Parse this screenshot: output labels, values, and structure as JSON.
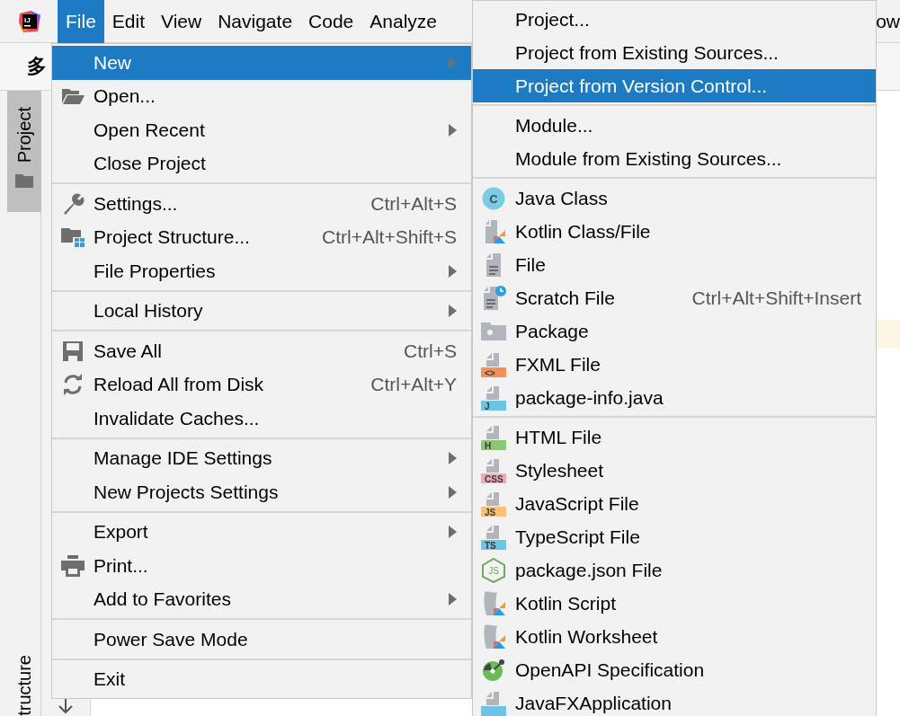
{
  "menubar": {
    "logo": "IJ",
    "items": [
      {
        "label": "File",
        "selected": true
      },
      {
        "label": "Edit",
        "selected": false
      },
      {
        "label": "View",
        "selected": false
      },
      {
        "label": "Navigate",
        "selected": false
      },
      {
        "label": "Code",
        "selected": false
      },
      {
        "label": "Analyze",
        "selected": false
      },
      {
        "label": "ow",
        "selected": false
      }
    ]
  },
  "toolbar_text": "多",
  "tool_windows": [
    {
      "label": "Project",
      "selected": true
    },
    {
      "label": "tructure",
      "selected": false
    }
  ],
  "file_menu": {
    "sections": [
      {
        "items": [
          {
            "label": "New",
            "selected": true,
            "submenu": true
          },
          {
            "label": "Open...",
            "selected": false,
            "submenu": false
          },
          {
            "label": "Open Recent",
            "selected": false,
            "submenu": true
          },
          {
            "label": "Close Project",
            "selected": false,
            "submenu": false
          }
        ]
      },
      {
        "items": [
          {
            "label": "Settings...",
            "shortcut": "Ctrl+Alt+S",
            "selected": false,
            "submenu": false
          },
          {
            "label": "Project Structure...",
            "shortcut": "Ctrl+Alt+Shift+S",
            "selected": false,
            "submenu": false
          },
          {
            "label": "File Properties",
            "selected": false,
            "submenu": true
          }
        ]
      },
      {
        "items": [
          {
            "label": "Local History",
            "selected": false,
            "submenu": true
          }
        ]
      },
      {
        "items": [
          {
            "label": "Save All",
            "shortcut": "Ctrl+S",
            "selected": false,
            "submenu": false
          },
          {
            "label": "Reload All from Disk",
            "shortcut": "Ctrl+Alt+Y",
            "selected": false,
            "submenu": false
          },
          {
            "label": "Invalidate Caches...",
            "selected": false,
            "submenu": false
          }
        ]
      },
      {
        "items": [
          {
            "label": "Manage IDE Settings",
            "selected": false,
            "submenu": true
          },
          {
            "label": "New Projects Settings",
            "selected": false,
            "submenu": true
          }
        ]
      },
      {
        "items": [
          {
            "label": "Export",
            "selected": false,
            "submenu": true
          },
          {
            "label": "Print...",
            "selected": false,
            "submenu": false
          },
          {
            "label": "Add to Favorites",
            "selected": false,
            "submenu": true
          }
        ]
      },
      {
        "items": [
          {
            "label": "Power Save Mode",
            "selected": false,
            "submenu": false
          }
        ]
      },
      {
        "items": [
          {
            "label": "Exit",
            "selected": false,
            "submenu": false
          }
        ]
      }
    ]
  },
  "new_submenu": {
    "sections": [
      {
        "items": [
          {
            "label": "Project...",
            "selected": false
          },
          {
            "label": "Project from Existing Sources...",
            "selected": false
          },
          {
            "label": "Project from Version Control...",
            "selected": true
          }
        ]
      },
      {
        "items": [
          {
            "label": "Module...",
            "selected": false
          },
          {
            "label": "Module from Existing Sources...",
            "selected": false
          }
        ]
      },
      {
        "items": [
          {
            "label": "Java Class",
            "badge": "C",
            "color": "#7ccbe4",
            "selected": false
          },
          {
            "label": "Kotlin Class/File",
            "selected": false
          },
          {
            "label": "File",
            "selected": false
          },
          {
            "label": "Scratch File",
            "shortcut": "Ctrl+Alt+Shift+Insert",
            "selected": false
          },
          {
            "label": "Package",
            "selected": false
          },
          {
            "label": "FXML File",
            "badge": "<>",
            "color": "#f0915a",
            "selected": false
          },
          {
            "label": "package-info.java",
            "badge": "J",
            "color": "#6ec4e6",
            "selected": false
          }
        ]
      },
      {
        "items": [
          {
            "label": "HTML File",
            "badge": "H",
            "color": "#8dc774",
            "selected": false
          },
          {
            "label": "Stylesheet",
            "badge": "CSS",
            "color": "#f4a7b9",
            "selected": false
          },
          {
            "label": "JavaScript File",
            "badge": "JS",
            "color": "#f5c276",
            "selected": false
          },
          {
            "label": "TypeScript File",
            "badge": "TS",
            "color": "#6ec4e6",
            "selected": false
          },
          {
            "label": "package.json File",
            "badge": "JS",
            "color": "#6aaa5a",
            "selected": false
          },
          {
            "label": "Kotlin Script",
            "selected": false
          },
          {
            "label": "Kotlin Worksheet",
            "selected": false
          },
          {
            "label": "OpenAPI Specification",
            "selected": false
          },
          {
            "label": "JavaFXApplication",
            "color": "#6ec4e6",
            "selected": false
          }
        ]
      }
    ]
  }
}
